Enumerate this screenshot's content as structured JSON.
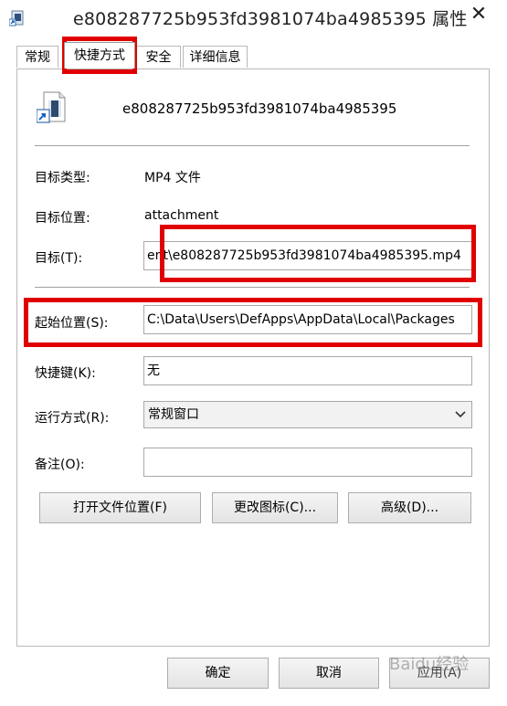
{
  "window": {
    "title": "e808287725b953fd3981074ba4985395 属性",
    "close_glyph": "✕"
  },
  "tabs": [
    {
      "label": "常规"
    },
    {
      "label": "快捷方式"
    },
    {
      "label": "安全"
    },
    {
      "label": "详细信息"
    }
  ],
  "shortcut": {
    "file_name": "e808287725b953fd3981074ba4985395",
    "target_type_label": "目标类型:",
    "target_type_value": "MP4 文件",
    "target_location_label": "目标位置:",
    "target_location_value": "attachment",
    "target_label": "目标(T):",
    "target_value": "ent\\e808287725b953fd3981074ba4985395.mp4",
    "start_in_label": "起始位置(S):",
    "start_in_value": "C:\\Data\\Users\\DefApps\\AppData\\Local\\Packages",
    "hotkey_label": "快捷键(K):",
    "hotkey_value": "无",
    "run_label": "运行方式(R):",
    "run_value": "常规窗口",
    "comment_label": "备注(O):",
    "comment_value": ""
  },
  "buttons": {
    "open_location": "打开文件位置(F)",
    "change_icon": "更改图标(C)...",
    "advanced": "高级(D)...",
    "ok": "确定",
    "cancel": "取消",
    "apply": "应用(A)"
  },
  "watermark": "Baidu经验",
  "colors": {
    "highlight": "#e00000"
  },
  "icons": {
    "app": "shortcut-app-icon",
    "file": "video-file-shortcut-icon",
    "dropdown": "chevron-down-icon"
  }
}
